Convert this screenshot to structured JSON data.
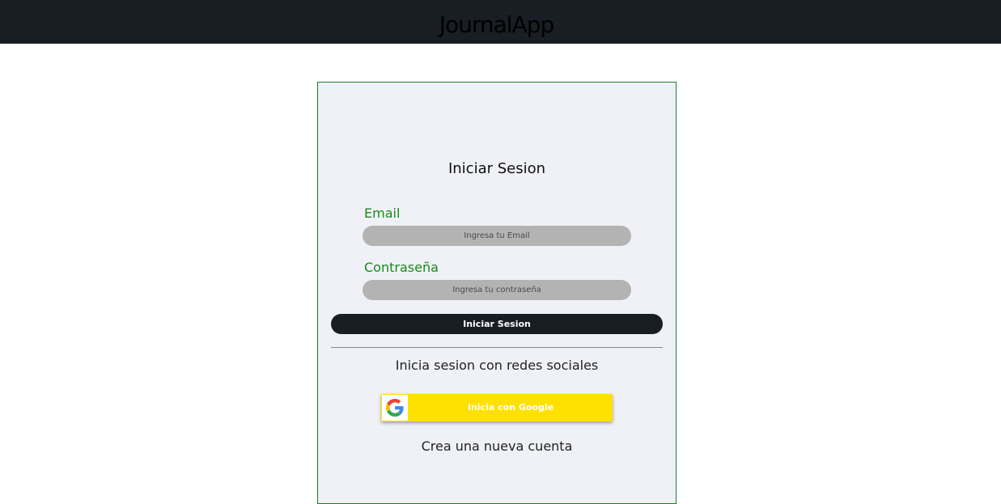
{
  "navbar": {
    "brand": "JournalApp"
  },
  "login": {
    "title": "Iniciar Sesion",
    "email": {
      "label": "Email",
      "placeholder": "Ingresa tu Email",
      "value": ""
    },
    "password": {
      "label": "Contraseña",
      "placeholder": "Ingresa tu contraseña",
      "value": ""
    },
    "submit_label": "Iniciar Sesion",
    "social_text": "Inicia sesion con redes sociales",
    "google_label": "Inicia con Google",
    "register_link": "Crea una nueva cuenta"
  },
  "colors": {
    "navbar_bg": "#191d24",
    "card_bg": "#f0f1f6",
    "card_border": "#1a7f2c",
    "label_green": "#1a8a1a",
    "google_yellow": "#ffe100"
  },
  "icons": {
    "google": "google-logo-icon"
  }
}
